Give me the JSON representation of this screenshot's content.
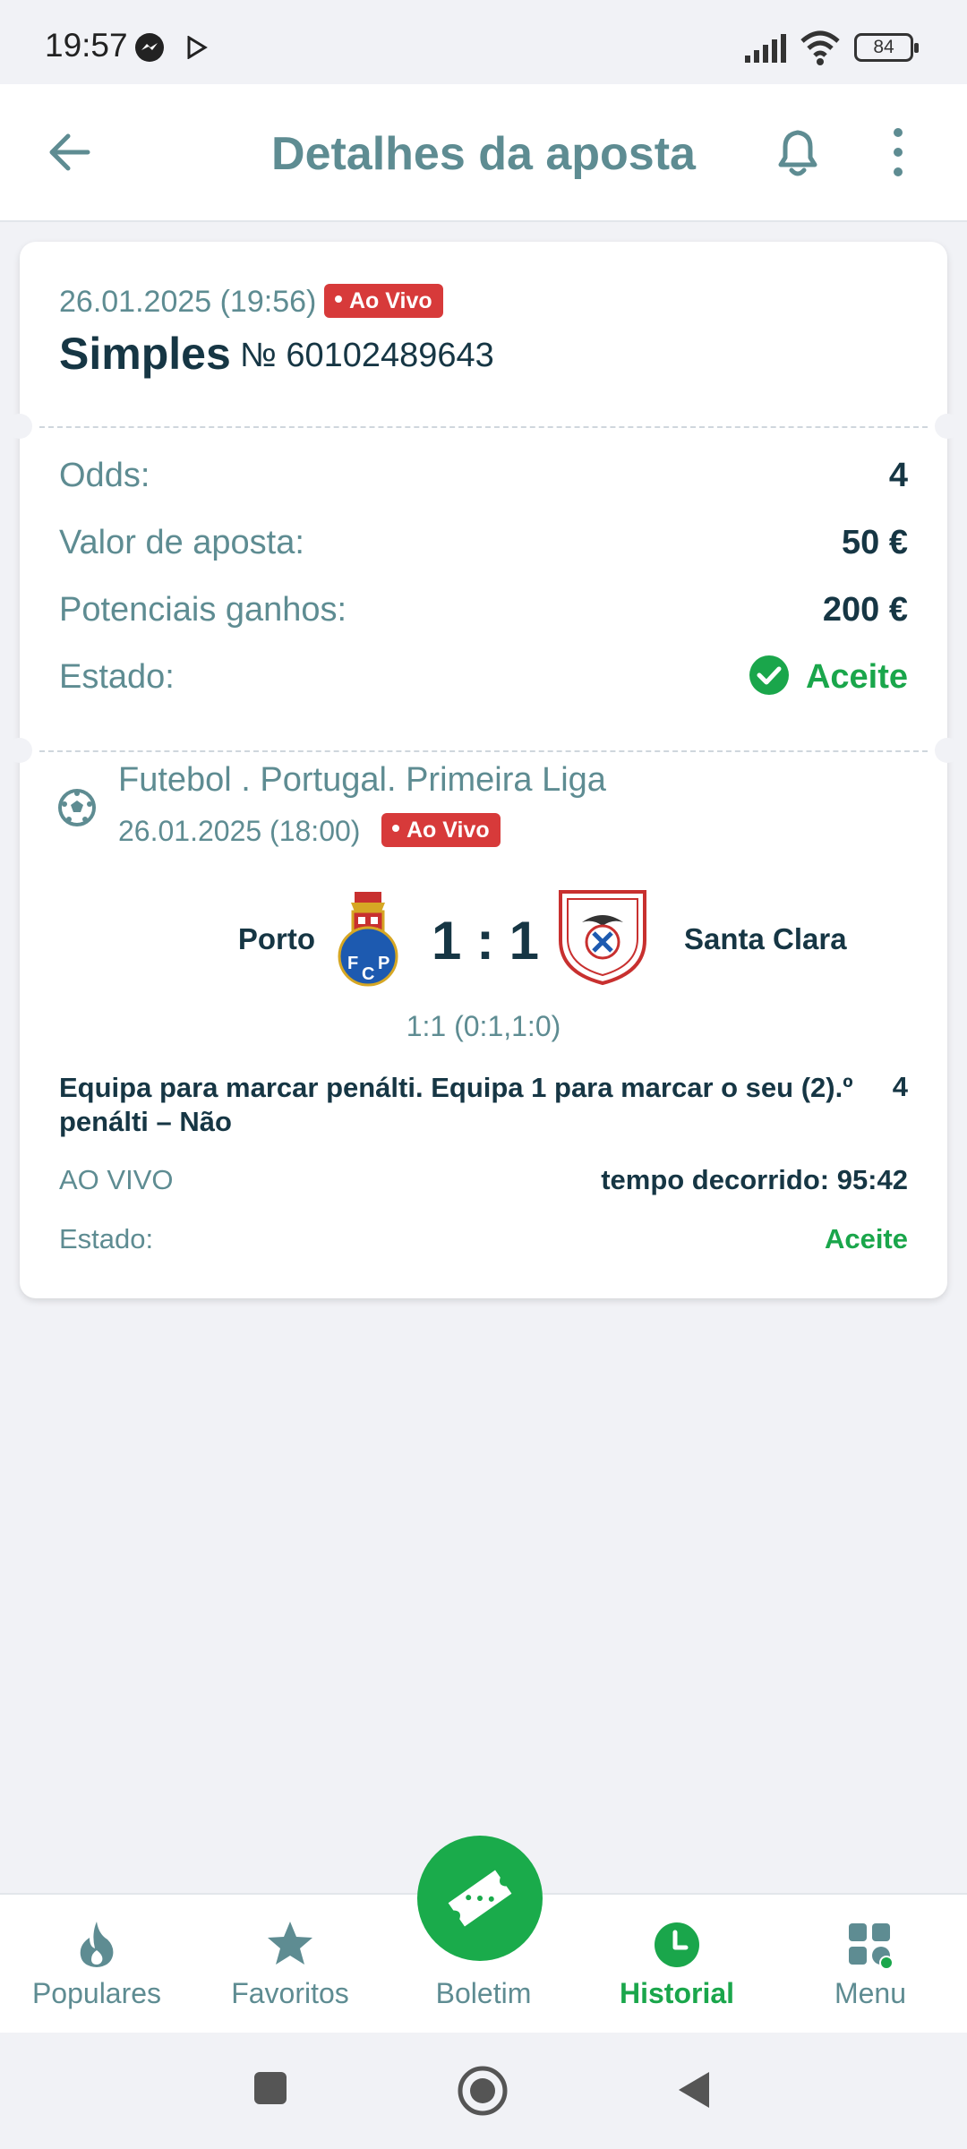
{
  "status_bar": {
    "time": "19:57",
    "battery": "84",
    "icons": [
      "messenger-icon",
      "play-icon",
      "signal-icon",
      "wifi-icon",
      "battery-icon"
    ]
  },
  "header": {
    "title": "Detalhes da aposta",
    "icons": [
      "back-arrow-icon",
      "bell-icon",
      "more-vertical-icon"
    ]
  },
  "bet": {
    "datetime": "26.01.2025 (19:56)",
    "live_badge": "Ao Vivo",
    "type": "Simples",
    "number": "№ 60102489643",
    "rows": [
      {
        "label": "Odds:",
        "value": "4"
      },
      {
        "label": "Valor de aposta:",
        "value": "50 €"
      },
      {
        "label": "Potenciais ganhos:",
        "value": "200 €"
      }
    ],
    "status_label": "Estado:",
    "status_value": "Aceite"
  },
  "event": {
    "league": "Futebol . Portugal. Primeira Liga",
    "datetime": "26.01.2025 (18:00)",
    "live_badge": "Ao Vivo",
    "home_team": "Porto",
    "away_team": "Santa Clara",
    "score": "1 : 1",
    "score_detail": "1:1 (0:1,1:0)",
    "market": "Equipa para marcar penálti. Equipa 1 para marcar o seu (2).º penálti – Não",
    "odds": "4",
    "live_label": "AO VIVO",
    "elapsed": "tempo decorrido: 95:42",
    "status_label": "Estado:",
    "status_value": "Aceite"
  },
  "bottom_nav": {
    "items": [
      {
        "label": "Populares",
        "icon": "flame-icon"
      },
      {
        "label": "Favoritos",
        "icon": "star-icon"
      },
      {
        "label": "Boletim",
        "icon": "ticket-icon"
      },
      {
        "label": "Historial",
        "icon": "clock-icon",
        "active": true
      },
      {
        "label": "Menu",
        "icon": "grid-menu-icon"
      }
    ]
  },
  "colors": {
    "accent_green": "#1aa64b",
    "live_red": "#d73a3a",
    "muted_teal": "#5e8c92",
    "dark_text": "#163644"
  }
}
